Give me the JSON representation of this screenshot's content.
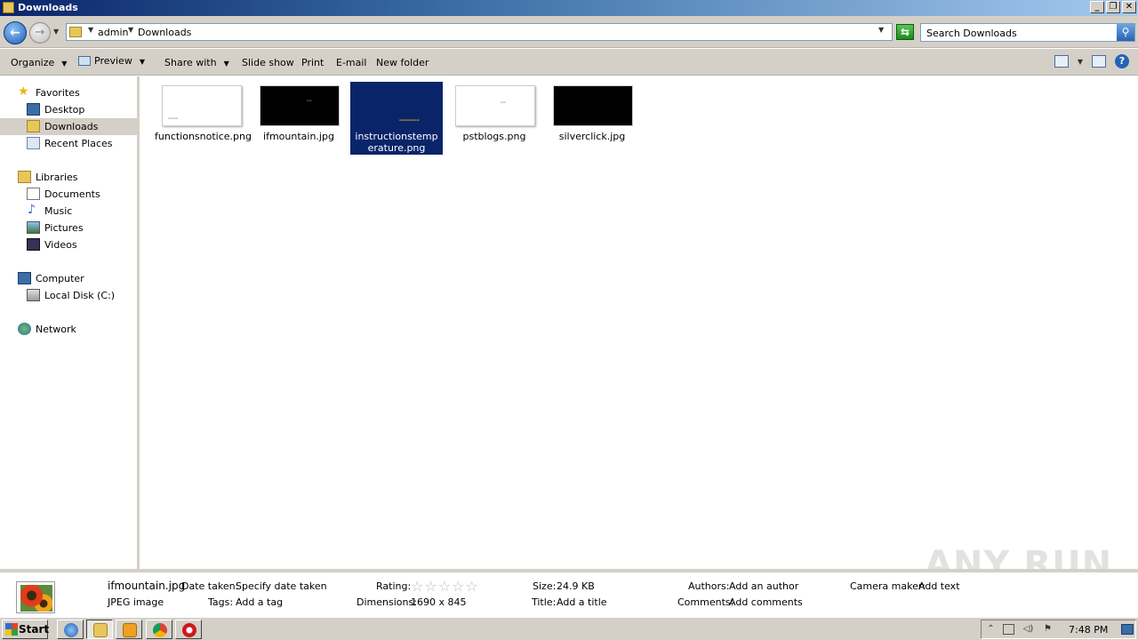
{
  "window": {
    "title": "Downloads"
  },
  "address": {
    "crumbs": [
      "admin",
      "Downloads"
    ],
    "search_placeholder": "Search Downloads"
  },
  "toolbar": {
    "organize": "Organize",
    "preview": "Preview",
    "share_with": "Share with",
    "slide_show": "Slide show",
    "print": "Print",
    "email": "E-mail",
    "new_folder": "New folder"
  },
  "nav": {
    "favorites": "Favorites",
    "desktop": "Desktop",
    "downloads": "Downloads",
    "recent_places": "Recent Places",
    "libraries": "Libraries",
    "documents": "Documents",
    "music": "Music",
    "pictures": "Pictures",
    "videos": "Videos",
    "computer": "Computer",
    "local_disk": "Local Disk (C:)",
    "network": "Network"
  },
  "files": [
    {
      "name": "functionsnotice.png",
      "thumb": "white"
    },
    {
      "name": "ifmountain.jpg",
      "thumb": "black"
    },
    {
      "name": "instructionstemperature.png",
      "thumb": "blue",
      "selected": true
    },
    {
      "name": "pstblogs.png",
      "thumb": "white"
    },
    {
      "name": "silverclick.jpg",
      "thumb": "black"
    }
  ],
  "details": {
    "filename": "ifmountain.jpg",
    "filetype": "JPEG image",
    "date_taken_label": "Date taken:",
    "date_taken_value": "Specify date taken",
    "tags_label": "Tags:",
    "tags_value": "Add a tag",
    "rating_label": "Rating:",
    "rating_stars": 0,
    "dimensions_label": "Dimensions:",
    "dimensions_value": "1690 x 845",
    "size_label": "Size:",
    "size_value": "24.9 KB",
    "title_label": "Title:",
    "title_value": "Add a title",
    "authors_label": "Authors:",
    "authors_value": "Add an author",
    "comments_label": "Comments:",
    "comments_value": "Add comments",
    "camera_label": "Camera maker:",
    "camera_value": "Add text"
  },
  "taskbar": {
    "start": "Start",
    "clock": "7:48 PM"
  },
  "watermark": "ANY RUN"
}
